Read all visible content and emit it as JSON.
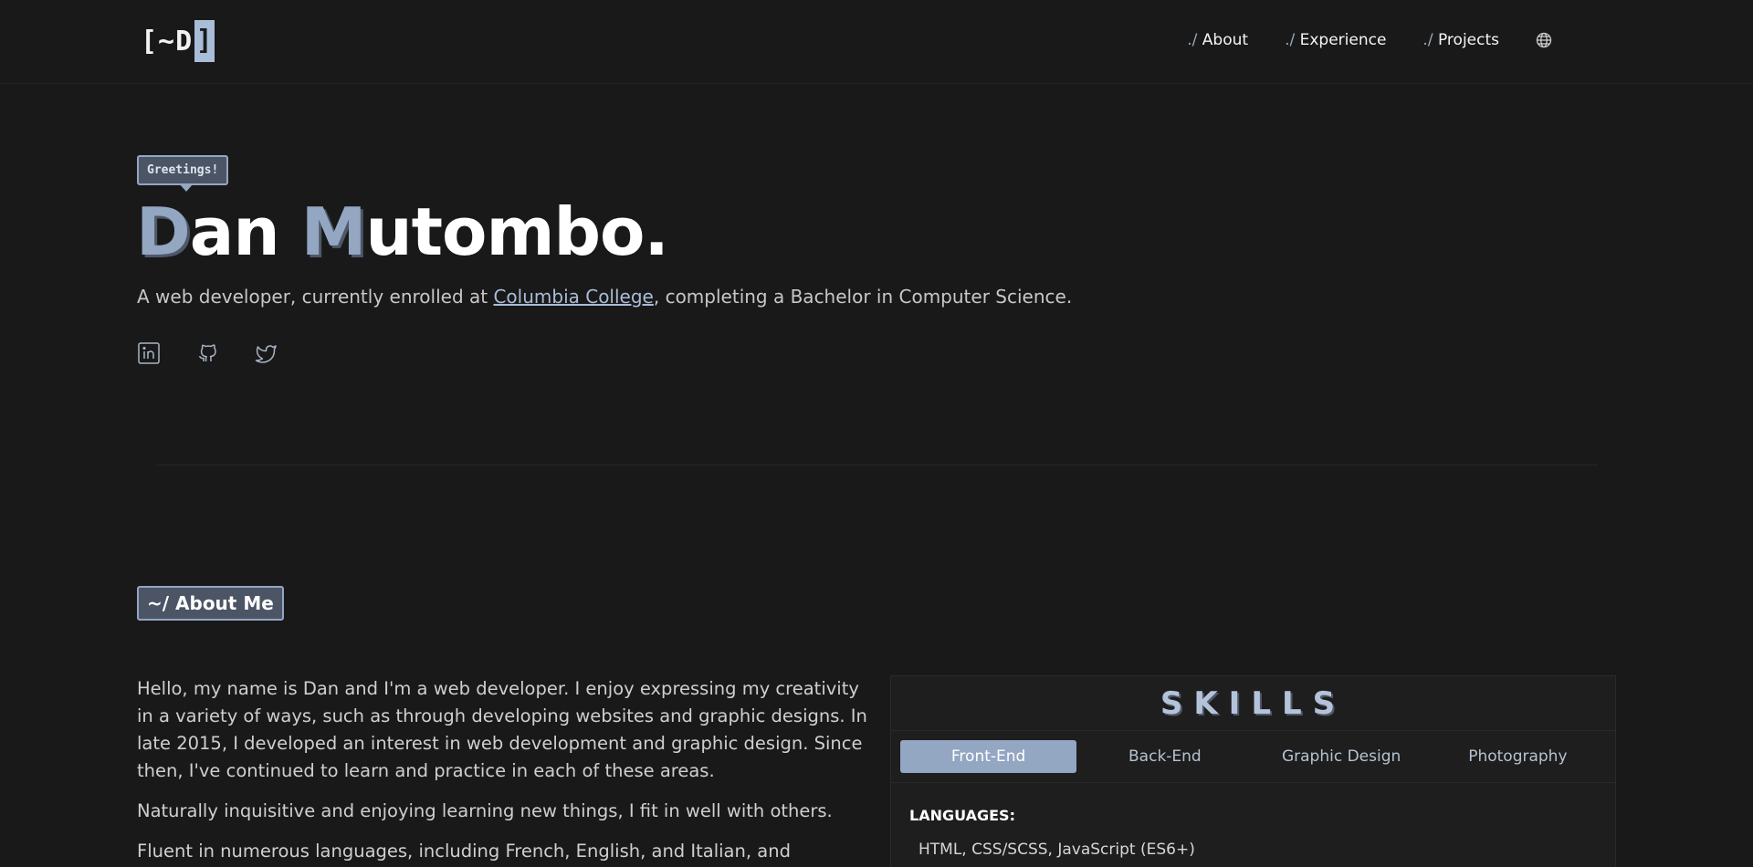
{
  "header": {
    "logo_prefix": "[~D",
    "logo_cursor": "]",
    "nav": [
      {
        "dot": "./",
        "label": "About"
      },
      {
        "dot": "./",
        "label": "Experience"
      },
      {
        "dot": "./",
        "label": "Projects"
      }
    ],
    "globe_icon": "globe-icon"
  },
  "hero": {
    "tooltip": "Greetings!",
    "name_first_initial": "D",
    "name_first_rest": "an ",
    "name_last_initial": "M",
    "name_last_rest": "utombo.",
    "subtitle_before": "A web developer, currently enrolled at ",
    "subtitle_link": "Columbia College",
    "subtitle_after": ", completing a Bachelor in Computer Science.",
    "socials": [
      "linkedin-icon",
      "github-icon",
      "twitter-icon"
    ]
  },
  "about": {
    "tag": "~/ About Me",
    "paragraphs": [
      "Hello, my name is Dan and I'm a web developer. I enjoy expressing my creativity in a variety of ways, such as through developing websites and graphic designs. In late 2015, I developed an interest in web development and graphic design. Since then, I've continued to learn and practice in each of these areas.",
      "Naturally inquisitive and enjoying learning new things, I fit in well with others.",
      "Fluent in numerous languages, including French, English, and Italian, and currently"
    ]
  },
  "skills": {
    "title": "SKILLS",
    "tabs": [
      "Front-End",
      "Back-End",
      "Graphic Design",
      "Photography"
    ],
    "active_tab": "Front-End",
    "languages_heading": "LANGUAGES:",
    "languages_value": "HTML, CSS/SCSS, JavaScript (ES6+)"
  },
  "colors": {
    "background": "#191919",
    "accent": "#93a6c2",
    "accent_light": "#a9bcd8",
    "tag_bg": "#4b5565"
  }
}
